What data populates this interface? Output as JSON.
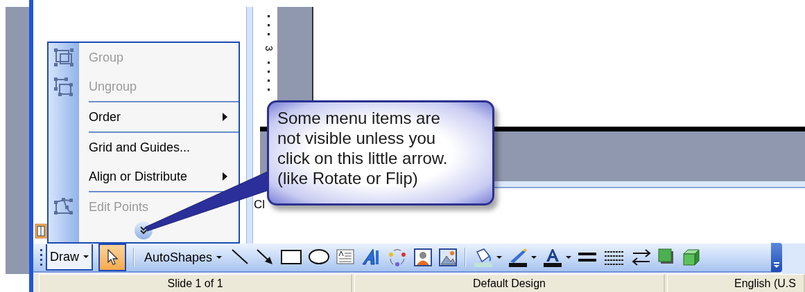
{
  "menu": {
    "items": [
      {
        "kind": "command",
        "label": "Group",
        "disabled": true
      },
      {
        "kind": "command",
        "label": "Ungroup",
        "disabled": true
      },
      {
        "kind": "separator"
      },
      {
        "kind": "submenu",
        "label": "Order",
        "disabled": false
      },
      {
        "kind": "separator"
      },
      {
        "kind": "command",
        "label": "Grid and Guides...",
        "disabled": false
      },
      {
        "kind": "submenu",
        "label": "Align or Distribute",
        "disabled": false
      },
      {
        "kind": "separator"
      },
      {
        "kind": "command",
        "label": "Edit Points",
        "disabled": true
      }
    ]
  },
  "callout": {
    "lines": [
      "Some menu items are",
      "not visible unless you",
      "click on this little arrow.",
      "(like Rotate or Flip)"
    ]
  },
  "ruler": {
    "label": "3"
  },
  "notes": {
    "text": "Cl"
  },
  "toolbar": {
    "draw": {
      "label": "Draw",
      "pressed": true
    },
    "select_tool": {
      "selected": true
    },
    "autoshapes": {
      "label": "AutoShapes"
    }
  },
  "status_bar": [
    "Slide 1 of 1",
    "Default Design",
    "English (U.S"
  ]
}
